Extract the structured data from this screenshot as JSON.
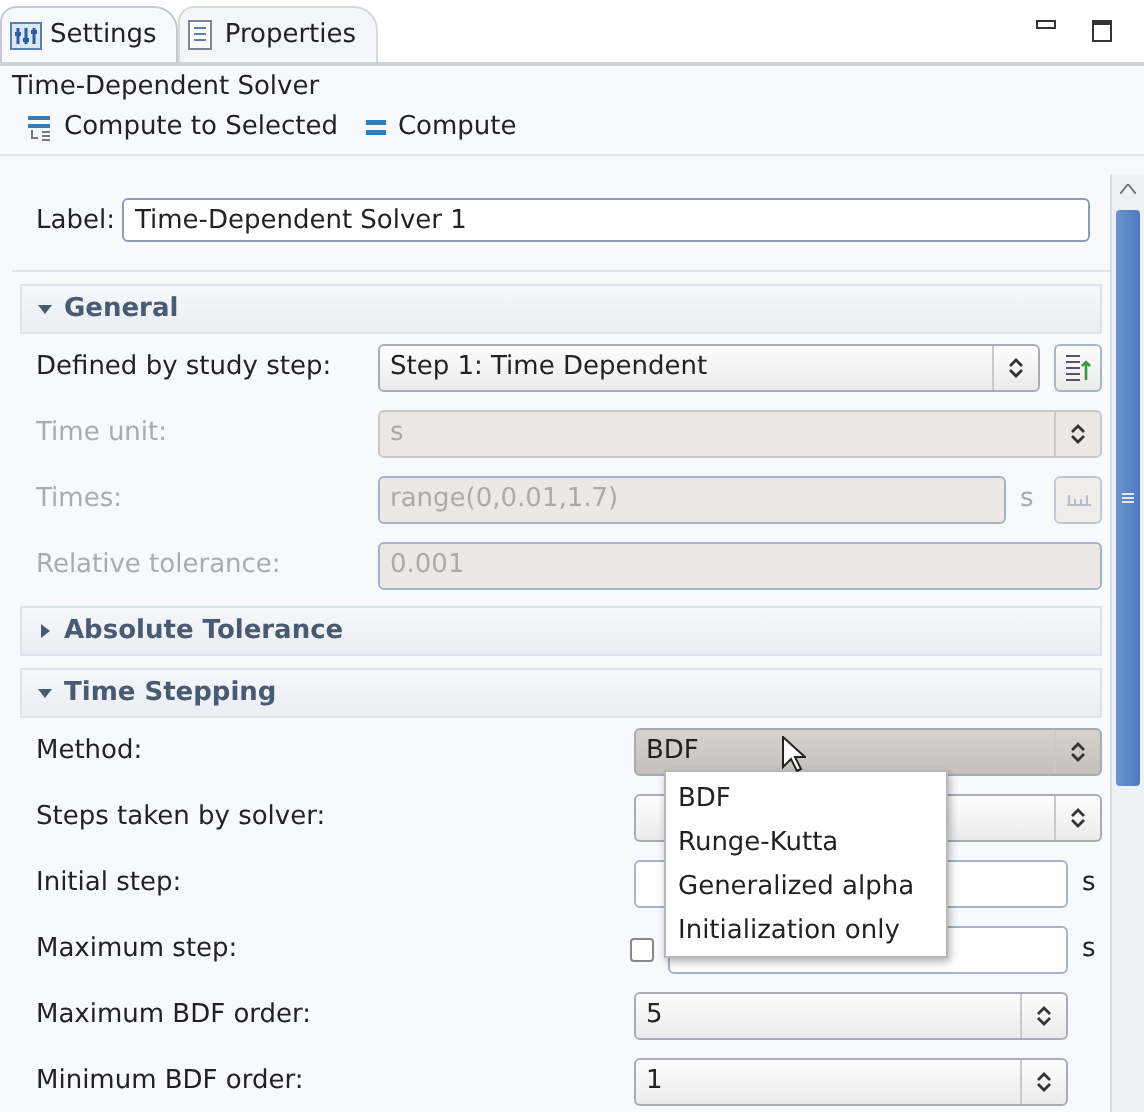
{
  "tabs": [
    {
      "label": "Settings",
      "selected": true
    },
    {
      "label": "Properties",
      "selected": false
    }
  ],
  "panel_title": "Time-Dependent Solver",
  "toolbar": [
    {
      "label": "Compute to Selected",
      "kind": "compute-selected"
    },
    {
      "label": "Compute",
      "kind": "compute"
    }
  ],
  "label_field": {
    "label": "Label:",
    "value": "Time-Dependent Solver 1"
  },
  "sections": [
    {
      "title": "General",
      "expanded": true,
      "rows": [
        {
          "kind": "select",
          "label": "Defined by study step:",
          "value": "Step 1: Time Dependent",
          "disabled": false,
          "side_button": true
        },
        {
          "kind": "select",
          "label": "Time unit:",
          "value": "s",
          "disabled": true
        },
        {
          "kind": "text",
          "label": "Times:",
          "value": "range(0,0.01,1.7)",
          "unit": "s",
          "disabled": true,
          "side_button": true
        },
        {
          "kind": "text",
          "label": "Relative tolerance:",
          "value": "0.001",
          "disabled": true
        }
      ]
    },
    {
      "title": "Absolute Tolerance",
      "expanded": false
    },
    {
      "title": "Time Stepping",
      "expanded": true,
      "rows": [
        {
          "kind": "select",
          "label": "Method:",
          "value": "BDF",
          "disabled": false,
          "open": true
        },
        {
          "kind": "select",
          "label": "Steps taken by solver:",
          "disabled": false
        },
        {
          "kind": "text",
          "label": "Initial step:",
          "unit": "s",
          "disabled": false
        },
        {
          "kind": "checkbox-text",
          "label": "Maximum step:",
          "unit": "s",
          "disabled": false,
          "checked": false
        },
        {
          "kind": "select",
          "label": "Maximum BDF order:",
          "value": "5",
          "disabled": false,
          "narrow": true
        },
        {
          "kind": "select",
          "label": "Minimum BDF order:",
          "value": "1",
          "disabled": false,
          "narrow": true
        }
      ]
    }
  ],
  "dropdown": {
    "items": [
      {
        "label": "BDF"
      },
      {
        "label": "Runge-Kutta"
      },
      {
        "label": "Generalized alpha"
      },
      {
        "label": "Initialization only"
      }
    ]
  }
}
